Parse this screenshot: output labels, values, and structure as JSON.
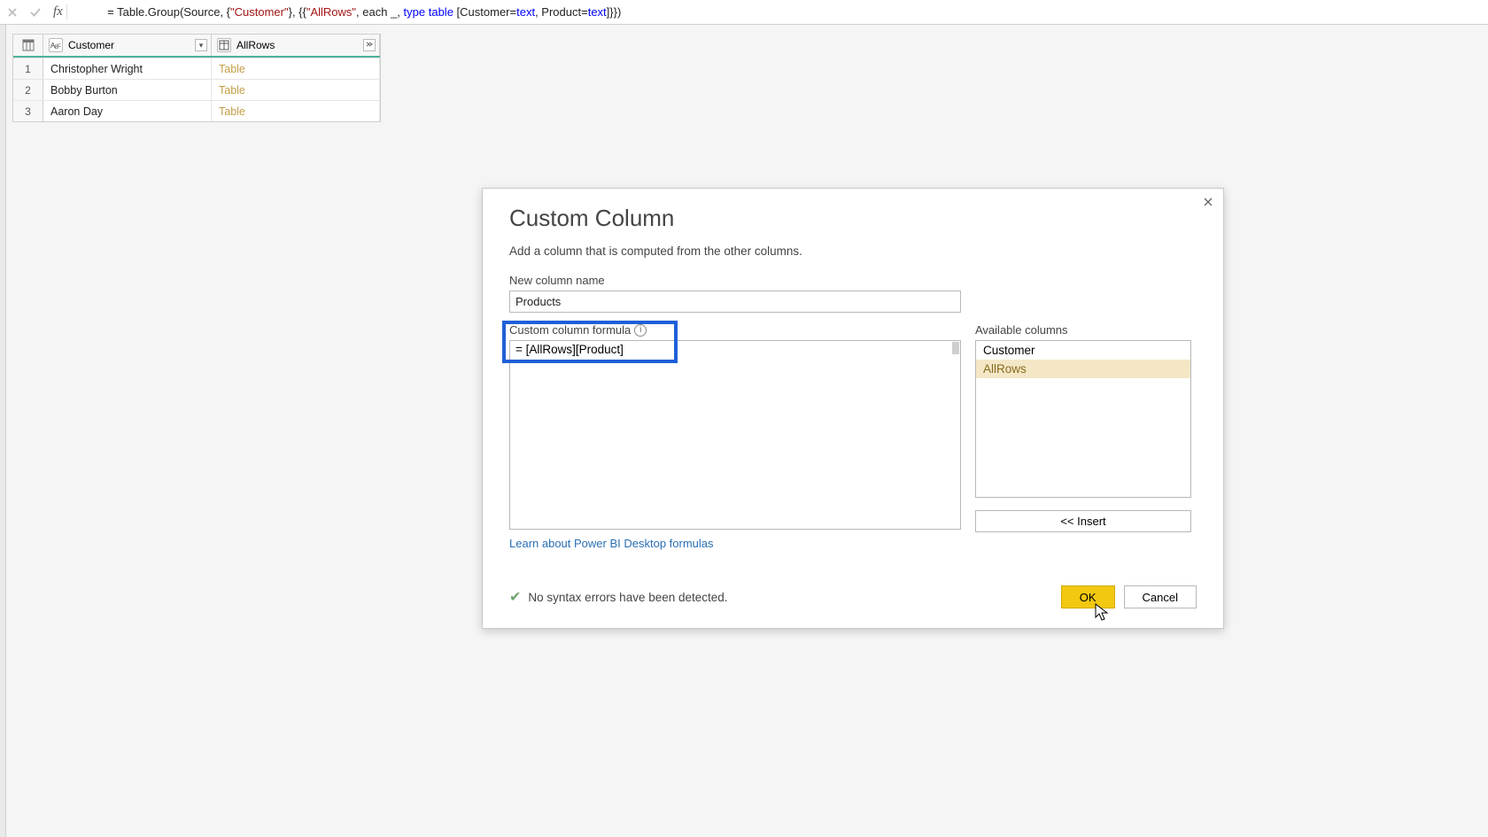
{
  "formulaBar": {
    "fxLabel": "fx",
    "prefix": "= ",
    "fn": "Table.Group",
    "open": "(Source, {",
    "arg1": "\"Customer\"",
    "mid": "}, {{",
    "arg2": "\"AllRows\"",
    "mid2": ", each _, ",
    "kwtype": "type",
    "mid3": " ",
    "kwtable": "table",
    "mid4": " [Customer=",
    "kwtext1": "text",
    "mid5": ", Product=",
    "kwtext2": "text",
    "tail": "]}})"
  },
  "grid": {
    "col1Header": "Customer",
    "col2Header": "AllRows",
    "typeIcon1": "ABC",
    "rows": [
      {
        "n": "1",
        "customer": "Christopher Wright",
        "allrows": "Table"
      },
      {
        "n": "2",
        "customer": "Bobby Burton",
        "allrows": "Table"
      },
      {
        "n": "3",
        "customer": "Aaron Day",
        "allrows": "Table"
      }
    ]
  },
  "dialog": {
    "title": "Custom Column",
    "desc": "Add a column that is computed from the other columns.",
    "newNameLabel": "New column name",
    "newNameValue": "Products",
    "formulaLabel": "Custom column formula",
    "formulaValue": "= [AllRows][Product]",
    "availLabel": "Available columns",
    "availItems": [
      "Customer",
      "AllRows"
    ],
    "insertLabel": "<< Insert",
    "learnLink": "Learn about Power BI Desktop formulas",
    "statusText": "No syntax errors have been detected.",
    "okLabel": "OK",
    "cancelLabel": "Cancel"
  }
}
